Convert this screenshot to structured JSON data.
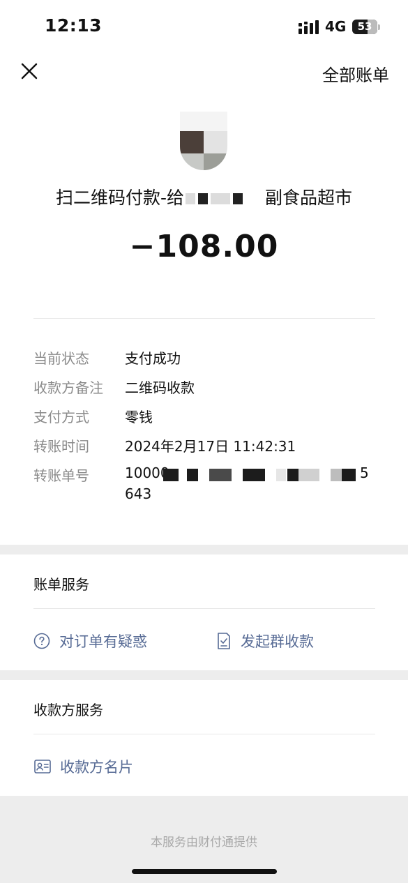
{
  "status_bar": {
    "time": "12:13",
    "network": "4G",
    "battery": "53"
  },
  "nav": {
    "all_bills": "全部账单"
  },
  "merchant": {
    "title_prefix": "扫二维码付款-给",
    "title_suffix": "副食品超市"
  },
  "amount": "−108.00",
  "details": [
    {
      "label": "当前状态",
      "value": "支付成功"
    },
    {
      "label": "收款方备注",
      "value": "二维码收款"
    },
    {
      "label": "支付方式",
      "value": "零钱"
    },
    {
      "label": "转账时间",
      "value": "2024年2月17日 11:42:31"
    },
    {
      "label": "转账单号",
      "value_start": "10000",
      "value_end": "5",
      "value_line2": "643"
    }
  ],
  "bill_service": {
    "title": "账单服务",
    "items": [
      {
        "label": "对订单有疑惑",
        "icon": "question-circle-icon"
      },
      {
        "label": "发起群收款",
        "icon": "group-collect-icon"
      }
    ]
  },
  "payee_service": {
    "title": "收款方服务",
    "items": [
      {
        "label": "收款方名片",
        "icon": "business-card-icon"
      }
    ]
  },
  "footer": {
    "text": "本服务由财付通提供"
  },
  "colors": {
    "link": "#576b95",
    "label_gray": "#8a8a8a",
    "section_gap": "#ededed"
  }
}
